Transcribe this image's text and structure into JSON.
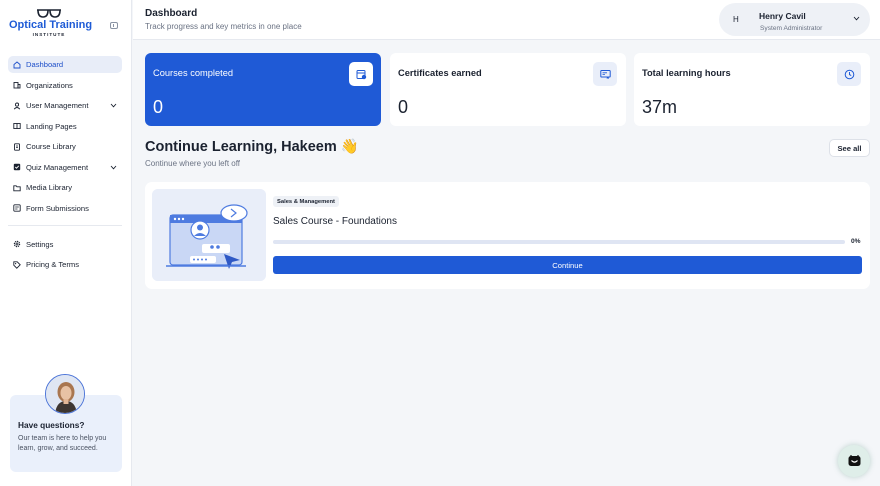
{
  "brand": {
    "name": "Optical Training",
    "sub": "INSTITUTE",
    "accent": "#1f5ad6"
  },
  "sidebar": {
    "items": [
      {
        "label": "Dashboard",
        "icon": "home-icon",
        "active": true
      },
      {
        "label": "Organizations",
        "icon": "building-icon"
      },
      {
        "label": "User Management",
        "icon": "user-icon",
        "expandable": true
      },
      {
        "label": "Landing Pages",
        "icon": "book-open-icon"
      },
      {
        "label": "Course Library",
        "icon": "document-icon"
      },
      {
        "label": "Quiz Management",
        "icon": "quiz-icon",
        "expandable": true
      },
      {
        "label": "Media Library",
        "icon": "folder-icon"
      },
      {
        "label": "Form Submissions",
        "icon": "form-icon"
      }
    ],
    "secondary": [
      {
        "label": "Settings",
        "icon": "gear-icon"
      },
      {
        "label": "Pricing & Terms",
        "icon": "tag-icon"
      }
    ],
    "help": {
      "title": "Have questions?",
      "text": "Our team is here to help you learn, grow, and succeed."
    }
  },
  "header": {
    "title": "Dashboard",
    "subtitle": "Track progress and key metrics in one place",
    "user": {
      "initial": "H",
      "name": "Henry Cavil",
      "role": "System Administrator"
    }
  },
  "stats": [
    {
      "label": "Courses completed",
      "value": "0",
      "icon": "calendar-check-icon"
    },
    {
      "label": "Certificates earned",
      "value": "0",
      "icon": "certificate-icon"
    },
    {
      "label": "Total learning hours",
      "value": "37m",
      "icon": "clock-icon"
    }
  ],
  "continue_learning": {
    "title": "Continue Learning, Hakeem 👋",
    "subtitle": "Continue where you left off",
    "see_all": "See all",
    "course": {
      "tag": "Sales & Management",
      "name": "Sales Course - Foundations",
      "progress_percent": 0,
      "progress_text": "0%",
      "button": "Continue"
    }
  }
}
